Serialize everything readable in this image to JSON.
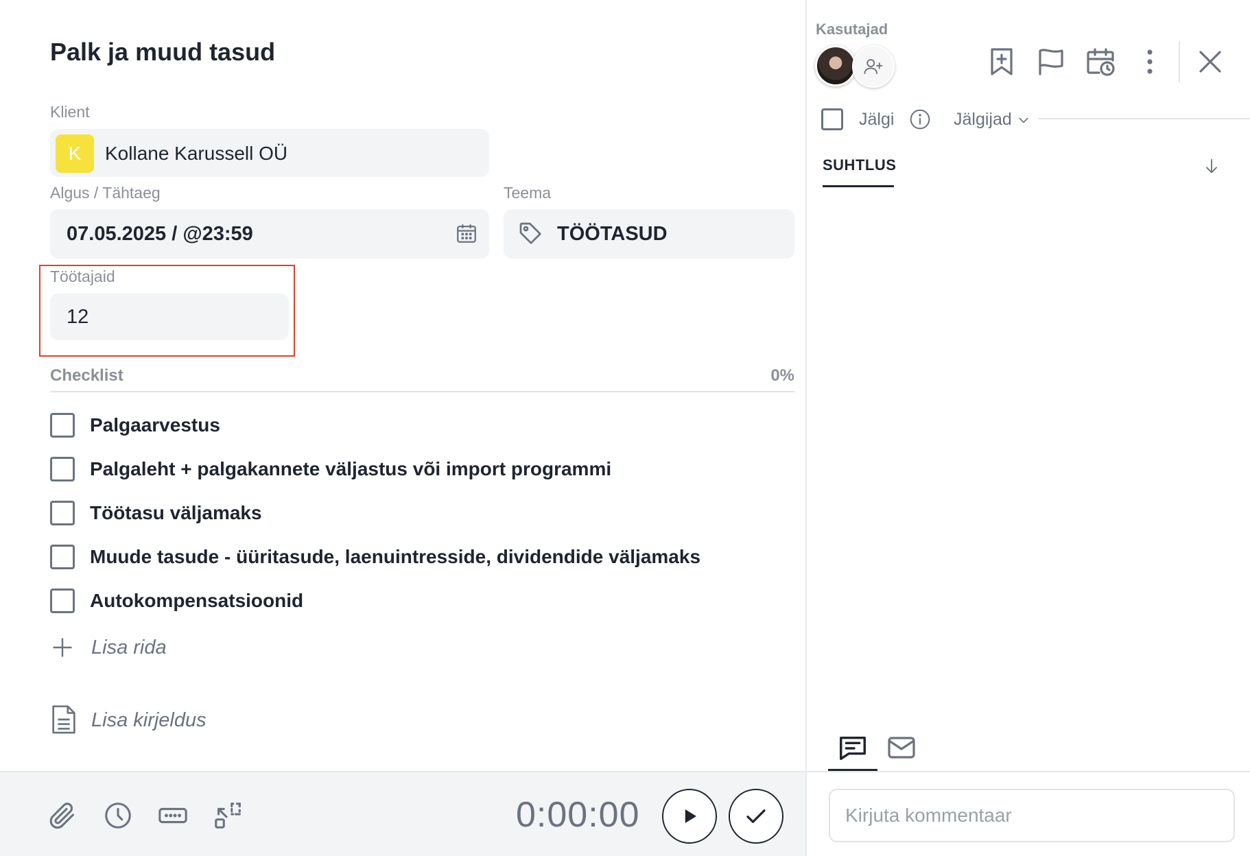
{
  "task": {
    "title": "Palk ja muud tasud"
  },
  "client": {
    "label": "Klient",
    "avatar_letter": "K",
    "avatar_color": "#f7e23d",
    "name": "Kollane Karussell OÜ"
  },
  "dates": {
    "label": "Algus / Tähtaeg",
    "value": "07.05.2025 / @23:59",
    "icon": "calendar-icon"
  },
  "theme": {
    "label": "Teema",
    "value": "TÖÖTASUD",
    "icon": "tag-icon"
  },
  "employees": {
    "label": "Töötajaid",
    "value": "12",
    "highlight_color": "#d9442c"
  },
  "checklist": {
    "label": "Checklist",
    "progress": "0%",
    "items": [
      {
        "label": "Palgaarvestus",
        "checked": false
      },
      {
        "label": "Palgaleht + palgakannete väljastus või import programmi",
        "checked": false
      },
      {
        "label": "Töötasu väljamaks",
        "checked": false
      },
      {
        "label": "Muude tasude - üüritasude, laenuintresside, dividendide väljamaks",
        "checked": false
      },
      {
        "label": "Autokompensatsioonid",
        "checked": false
      }
    ],
    "add_row": "Lisa rida"
  },
  "description": {
    "placeholder": "Lisa kirjeldus"
  },
  "footer": {
    "timer": "0:00:00",
    "icons": [
      "paperclip-icon",
      "clock-icon",
      "keyboard-icon",
      "collapse-icon",
      "play-icon",
      "check-icon"
    ]
  },
  "sidebar": {
    "users_label": "Kasutajad",
    "follow_label": "Jälgi",
    "followers_label": "Jälgijad",
    "tab_communication": "SUHTLUS",
    "comment_placeholder": "Kirjuta kommentaar",
    "icons": [
      "bookmark-plus-icon",
      "flag-icon",
      "calendar-clock-icon",
      "more-vertical-icon",
      "close-icon"
    ]
  }
}
